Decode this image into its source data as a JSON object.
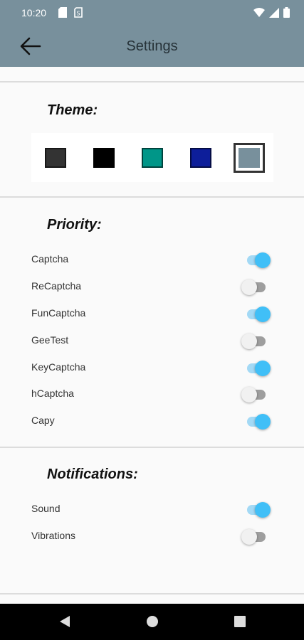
{
  "status_bar": {
    "time": "10:20",
    "icons": [
      "sd-card-icon",
      "sim-card-icon",
      "wifi-icon",
      "signal-icon",
      "battery-icon"
    ]
  },
  "app_bar": {
    "back_icon": "arrow-back-icon",
    "title": "Settings",
    "background": "#78909c"
  },
  "theme": {
    "heading": "Theme:",
    "swatches": [
      {
        "name": "dark-gray",
        "color": "#333333",
        "selected": false
      },
      {
        "name": "black",
        "color": "#000000",
        "selected": false
      },
      {
        "name": "teal",
        "color": "#009688",
        "selected": false
      },
      {
        "name": "indigo",
        "color": "#0d1e9a",
        "selected": false
      },
      {
        "name": "blue-gray",
        "color": "#78909c",
        "selected": true
      }
    ]
  },
  "priority": {
    "heading": "Priority:",
    "items": [
      {
        "label": "Captcha",
        "on": true
      },
      {
        "label": "ReCaptcha",
        "on": false
      },
      {
        "label": "FunCaptcha",
        "on": true
      },
      {
        "label": "GeeTest",
        "on": false
      },
      {
        "label": "KeyCaptcha",
        "on": true
      },
      {
        "label": "hCaptcha",
        "on": false
      },
      {
        "label": "Capy",
        "on": true
      }
    ]
  },
  "notifications": {
    "heading": "Notifications:",
    "items": [
      {
        "label": "Sound",
        "on": true
      },
      {
        "label": "Vibrations",
        "on": false
      }
    ]
  },
  "nav_bar": {
    "buttons": [
      "back-triangle-icon",
      "home-circle-icon",
      "recents-square-icon"
    ]
  },
  "colors": {
    "accent": "#40bff7",
    "accent_track": "#a3d9f5"
  }
}
